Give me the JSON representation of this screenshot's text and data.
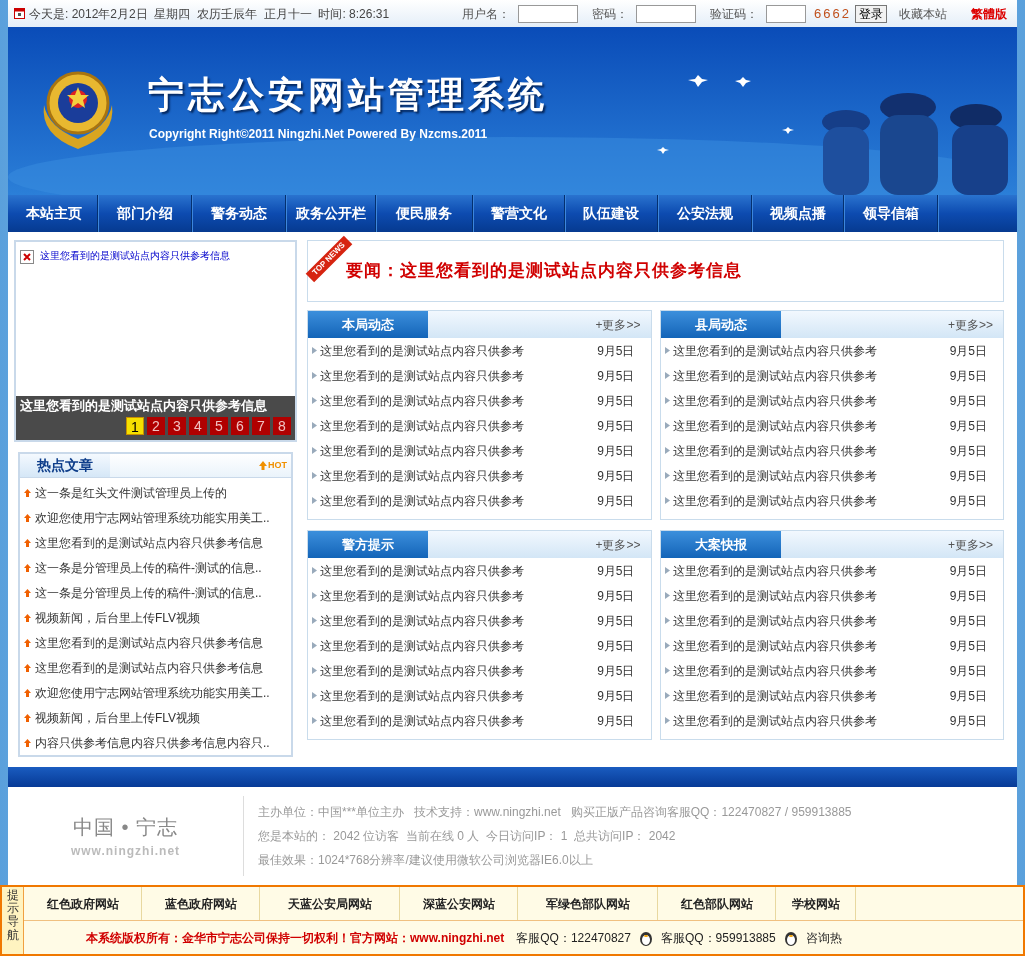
{
  "topbar": {
    "date_text": "今天是: 2012年2月2日  星期四  农历壬辰年  正月十一  时间: 8:26:31",
    "username_label": "用户名：",
    "password_label": "密码：",
    "captcha_label": "验证码：",
    "captcha_code": "6662",
    "login_button": "登录",
    "bookmark": "收藏本站",
    "traditional": "繁體版"
  },
  "banner": {
    "title": "宁志公安网站管理系统",
    "copyright": "Copyright Right©2011 Ningzhi.Net Powered By Nzcms.2011"
  },
  "nav": [
    "本站主页",
    "部门介绍",
    "警务动态",
    "政务公开栏",
    "便民服务",
    "警营文化",
    "队伍建设",
    "公安法规",
    "视频点播",
    "领导信箱"
  ],
  "slideshow": {
    "image_alt": "这里您看到的是测试站点内容只供参考信息",
    "caption": "这里您看到的是测试站点内容只供参考信息",
    "pages": [
      {
        "label": "1",
        "selected": true
      },
      {
        "label": "2",
        "selected": false
      },
      {
        "label": "3",
        "selected": false
      },
      {
        "label": "4",
        "selected": false
      },
      {
        "label": "5",
        "selected": false
      },
      {
        "label": "6",
        "selected": false
      },
      {
        "label": "7",
        "selected": false
      },
      {
        "label": "8",
        "selected": false
      }
    ]
  },
  "hot": {
    "title": "热点文章",
    "badge": "HOT",
    "items": [
      "这一条是红头文件测试管理员上传的",
      "欢迎您使用宁志网站管理系统功能实用美工..",
      "这里您看到的是测试站点内容只供参考信息",
      "这一条是分管理员上传的稿件-测试的信息..",
      "这一条是分管理员上传的稿件-测试的信息..",
      "视频新闻，后台里上传FLV视频",
      "这里您看到的是测试站点内容只供参考信息",
      "这里您看到的是测试站点内容只供参考信息",
      "欢迎您使用宁志网站管理系统功能实用美工..",
      "视频新闻，后台里上传FLV视频",
      "内容只供参考信息内容只供参考信息内容只.."
    ]
  },
  "headline": {
    "ribbon": "TOP NEWS",
    "text": "要闻：这里您看到的是测试站点内容只供参考信息"
  },
  "panels": [
    {
      "title": "本局动态",
      "more": "+更多>>",
      "items": [
        {
          "title": "这里您看到的是测试站点内容只供参考",
          "date": "9月5日"
        },
        {
          "title": "这里您看到的是测试站点内容只供参考",
          "date": "9月5日"
        },
        {
          "title": "这里您看到的是测试站点内容只供参考",
          "date": "9月5日"
        },
        {
          "title": "这里您看到的是测试站点内容只供参考",
          "date": "9月5日"
        },
        {
          "title": "这里您看到的是测试站点内容只供参考",
          "date": "9月5日"
        },
        {
          "title": "这里您看到的是测试站点内容只供参考",
          "date": "9月5日"
        },
        {
          "title": "这里您看到的是测试站点内容只供参考",
          "date": "9月5日"
        }
      ]
    },
    {
      "title": "县局动态",
      "more": "+更多>>",
      "items": [
        {
          "title": "这里您看到的是测试站点内容只供参考",
          "date": "9月5日"
        },
        {
          "title": "这里您看到的是测试站点内容只供参考",
          "date": "9月5日"
        },
        {
          "title": "这里您看到的是测试站点内容只供参考",
          "date": "9月5日"
        },
        {
          "title": "这里您看到的是测试站点内容只供参考",
          "date": "9月5日"
        },
        {
          "title": "这里您看到的是测试站点内容只供参考",
          "date": "9月5日"
        },
        {
          "title": "这里您看到的是测试站点内容只供参考",
          "date": "9月5日"
        },
        {
          "title": "这里您看到的是测试站点内容只供参考",
          "date": "9月5日"
        }
      ]
    },
    {
      "title": "警方提示",
      "more": "+更多>>",
      "items": [
        {
          "title": "这里您看到的是测试站点内容只供参考",
          "date": "9月5日"
        },
        {
          "title": "这里您看到的是测试站点内容只供参考",
          "date": "9月5日"
        },
        {
          "title": "这里您看到的是测试站点内容只供参考",
          "date": "9月5日"
        },
        {
          "title": "这里您看到的是测试站点内容只供参考",
          "date": "9月5日"
        },
        {
          "title": "这里您看到的是测试站点内容只供参考",
          "date": "9月5日"
        },
        {
          "title": "这里您看到的是测试站点内容只供参考",
          "date": "9月5日"
        },
        {
          "title": "这里您看到的是测试站点内容只供参考",
          "date": "9月5日"
        }
      ]
    },
    {
      "title": "大案快报",
      "more": "+更多>>",
      "items": [
        {
          "title": "这里您看到的是测试站点内容只供参考",
          "date": "9月5日"
        },
        {
          "title": "这里您看到的是测试站点内容只供参考",
          "date": "9月5日"
        },
        {
          "title": "这里您看到的是测试站点内容只供参考",
          "date": "9月5日"
        },
        {
          "title": "这里您看到的是测试站点内容只供参考",
          "date": "9月5日"
        },
        {
          "title": "这里您看到的是测试站点内容只供参考",
          "date": "9月5日"
        },
        {
          "title": "这里您看到的是测试站点内容只供参考",
          "date": "9月5日"
        },
        {
          "title": "这里您看到的是测试站点内容只供参考",
          "date": "9月5日"
        }
      ]
    }
  ],
  "footer": {
    "logo_text": "中国 • 宁志",
    "logo_url": "www.ningzhi.net",
    "lines": [
      "主办单位：中国***单位主办   技术支持：www.ningzhi.net   购买正版产品咨询客服QQ：122470827 / 959913885",
      "您是本站的： 2042 位访客  当前在线 0 人  今日访问IP： 1  总共访问IP： 2042",
      "最佳效果：1024*768分辨率/建议使用微软公司浏览器IE6.0以上"
    ]
  },
  "bottom_bar": {
    "label": "提示导航",
    "links": [
      "红色政府网站",
      "蓝色政府网站",
      "天蓝公安局网站",
      "深蓝公安网站",
      "军绿色部队网站",
      "红色部队网站",
      "学校网站"
    ],
    "copyright": "本系统版权所有：金华市宁志公司保持一切权利！官方网站：www.ningzhi.net",
    "qq": [
      "客服QQ：122470827",
      "客服QQ：959913885"
    ],
    "hotline": "咨询热"
  }
}
